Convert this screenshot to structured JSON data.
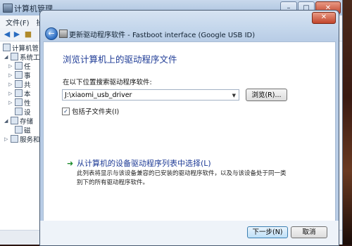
{
  "mgmt_window": {
    "title": "计算机管理",
    "menu": [
      "文件(F)",
      "操作(A)"
    ],
    "tree": [
      {
        "label": "计算机管"
      },
      {
        "label": "系统工"
      },
      {
        "label": "任"
      },
      {
        "label": "事"
      },
      {
        "label": "共"
      },
      {
        "label": "本"
      },
      {
        "label": "性"
      },
      {
        "label": "设"
      },
      {
        "label": "存储"
      },
      {
        "label": "磁"
      },
      {
        "label": "服务和"
      }
    ]
  },
  "dialog": {
    "title": "更新驱动程序软件 - Fastboot interface (Google USB ID)",
    "heading": "浏览计算机上的驱动程序文件",
    "search_label": "在以下位置搜索驱动程序软件:",
    "path_value": "J:\\xiaomi_usb_driver",
    "browse_label": "浏览(R)...",
    "include_subfolders_label": "包括子文件夹(I)",
    "include_subfolders_checked": true,
    "option_title": "从计算机的设备驱动程序列表中选择(L)",
    "option_desc": "此列表将显示与该设备兼容的已安装的驱动程序软件，以及与该设备处于同一类别下的所有驱动程序软件。",
    "next_label": "下一步(N)",
    "cancel_label": "取消"
  }
}
